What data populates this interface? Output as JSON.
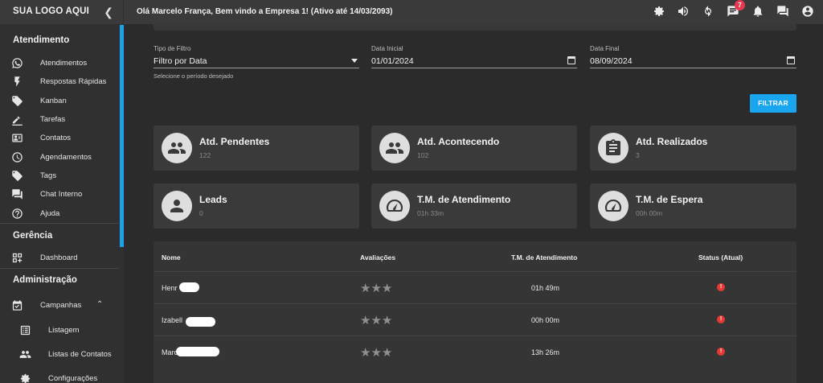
{
  "app": {
    "logo": "SUA LOGO AQUI",
    "welcome": "Olá Marcelo França, Bem vindo a Empresa 1! (Ativo até 14/03/2093)",
    "notification_count": "7"
  },
  "sidebar": {
    "section_atendimento": "Atendimento",
    "items_atendimento": [
      {
        "label": "Atendimentos",
        "icon": "whatsapp-icon"
      },
      {
        "label": "Respostas Rápidas",
        "icon": "bolt-icon"
      },
      {
        "label": "Kanban",
        "icon": "tag-icon"
      },
      {
        "label": "Tarefas",
        "icon": "pencil-icon"
      },
      {
        "label": "Contatos",
        "icon": "contact-card-icon"
      },
      {
        "label": "Agendamentos",
        "icon": "clock-icon"
      },
      {
        "label": "Tags",
        "icon": "tag-icon"
      },
      {
        "label": "Chat Interno",
        "icon": "chat-icon"
      },
      {
        "label": "Ajuda",
        "icon": "help-icon"
      }
    ],
    "section_gerencia": "Gerência",
    "dashboard": "Dashboard",
    "section_administracao": "Administração",
    "campanhas": "Campanhas",
    "listagem": "Listagem",
    "listas_contatos": "Listas de Contatos",
    "configuracoes": "Configurações"
  },
  "filters": {
    "tipo_label": "Tipo de Filtro",
    "tipo_value": "Filtro por Data",
    "tipo_helper": "Selecione o período desejado",
    "inicial_label": "Data Inicial",
    "inicial_value": "01/01/2024",
    "final_label": "Data Final",
    "final_value": "08/09/2024",
    "button": "FILTRAR"
  },
  "stats": [
    {
      "title": "Atd. Pendentes",
      "value": "122",
      "icon": "group-icon"
    },
    {
      "title": "Atd. Acontecendo",
      "value": "102",
      "icon": "group-icon"
    },
    {
      "title": "Atd. Realizados",
      "value": "3",
      "icon": "clipboard-icon"
    },
    {
      "title": "Leads",
      "value": "0",
      "icon": "person-icon"
    },
    {
      "title": "T.M. de Atendimento",
      "value": "01h 33m",
      "icon": "speedometer-icon"
    },
    {
      "title": "T.M. de Espera",
      "value": "00h 00m",
      "icon": "speedometer-icon"
    }
  ],
  "table": {
    "headers": [
      "Nome",
      "Avaliações",
      "T.M. de Atendimento",
      "Status (Atual)"
    ],
    "rows": [
      {
        "name": "Henr",
        "stars": "★★★",
        "tm": "01h 49m",
        "status": "!"
      },
      {
        "name": "Izabell",
        "stars": "★★★",
        "tm": "00h 00m",
        "status": "!"
      },
      {
        "name": "Marc",
        "stars": "★★★",
        "tm": "13h 26m",
        "status": "!"
      }
    ]
  }
}
